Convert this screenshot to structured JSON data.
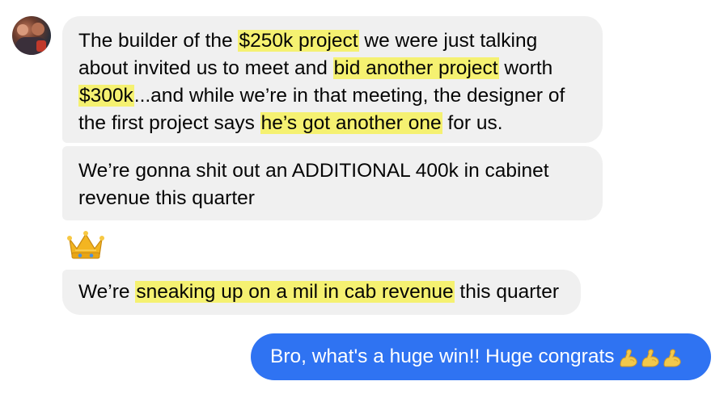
{
  "conversation": {
    "received": [
      {
        "segments": [
          {
            "text": "The builder of the ",
            "highlight": false
          },
          {
            "text": "$250k project",
            "highlight": true
          },
          {
            "text": " we were just talking about invited us to meet and ",
            "highlight": false
          },
          {
            "text": "bid another project",
            "highlight": true
          },
          {
            "text": " worth ",
            "highlight": false
          },
          {
            "text": "$300k",
            "highlight": true
          },
          {
            "text": "...and while we’re in that meeting, the designer of the first project says ",
            "highlight": false
          },
          {
            "text": "he’s got another one",
            "highlight": true
          },
          {
            "text": " for us.",
            "highlight": false
          }
        ]
      },
      {
        "text": "We’re gonna shit out an ADDITIONAL 400k in cabinet revenue this quarter"
      },
      {
        "emoji": "crown-emoji"
      },
      {
        "segments": [
          {
            "text": "We’re ",
            "highlight": false
          },
          {
            "text": "sneaking up on a mil in cab revenue",
            "highlight": true
          },
          {
            "text": " this quarter",
            "highlight": false
          }
        ]
      }
    ],
    "sent": {
      "text": "Bro, what's a huge win!! Huge congrats",
      "emoji": [
        "flexed-biceps-emoji",
        "flexed-biceps-emoji",
        "flexed-biceps-emoji"
      ]
    }
  },
  "colors": {
    "received_bubble": "#f0f0f0",
    "sent_bubble": "#2f73f2",
    "highlight": "#f5f171",
    "sent_text": "#ffffff"
  }
}
